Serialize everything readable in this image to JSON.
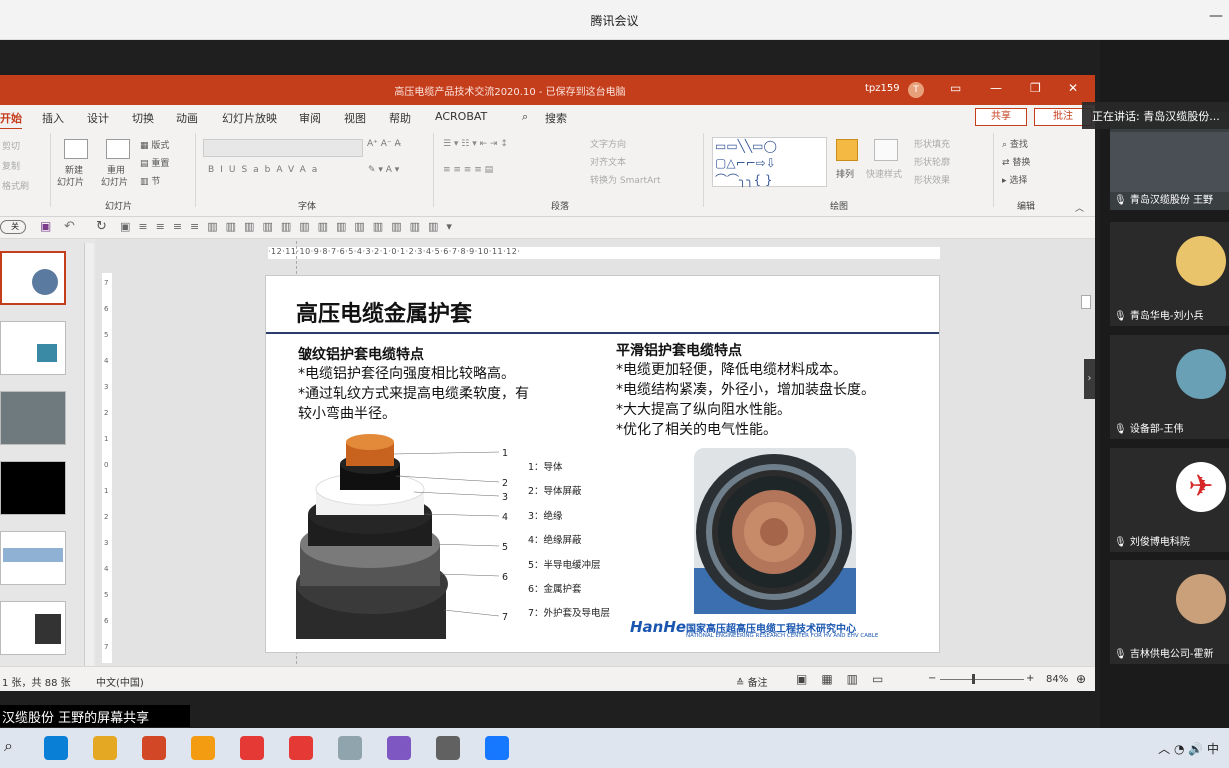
{
  "window": {
    "title": "腾讯会议",
    "min": "—"
  },
  "ppt": {
    "doc_title": "高压电缆产品技术交流2020.10 - 已保存到这台电脑",
    "user": "tpz159",
    "avatar": "T",
    "tabs": [
      "开始",
      "插入",
      "设计",
      "切换",
      "动画",
      "幻灯片放映",
      "审阅",
      "视图",
      "帮助",
      "ACROBAT"
    ],
    "search": "搜索",
    "share": "共享",
    "comment": "批注",
    "ribbon": {
      "clipboard": [
        "剪切",
        "复制",
        "格式刷"
      ],
      "slides": {
        "new": "新建",
        "new2": "幻灯片",
        "reuse": "重用",
        "reuse2": "幻灯片",
        "layout": "版式",
        "reset": "重置",
        "section": "节",
        "group": "幻灯片"
      },
      "font": {
        "group": "字体",
        "letters": [
          "B",
          "I",
          "U",
          "S",
          "ab",
          "AV",
          "Aa"
        ]
      },
      "paragraph": {
        "group": "段落",
        "text_dir": "文字方向",
        "align_text": "对齐文本",
        "smartart": "转换为 SmartArt"
      },
      "drawing": {
        "group": "绘图",
        "arrange": "排列",
        "quick_styles": "快速样式",
        "fill": "形状填充",
        "outline": "形状轮廓",
        "effects": "形状效果"
      },
      "editing": {
        "group": "编辑",
        "find": "查找",
        "replace": "替换",
        "select": "选择"
      }
    },
    "ruler": "·12·11·10·9·8·7·6·5·4·3·2·1·0·1·2·3·4·5·6·7·8·9·10·11·12·",
    "toggle_label": "关",
    "slide": {
      "title": "高压电缆金属护套",
      "left_heading": "皱纹铝护套电缆特点",
      "left_bullets": [
        "*电缆铝护套径向强度相比较略高。",
        "*通过轧纹方式来提高电缆柔软度，有",
        "较小弯曲半径。"
      ],
      "right_heading": "平滑铝护套电缆特点",
      "right_bullets": [
        "*电缆更加轻便，降低电缆材料成本。",
        "*电缆结构紧凑，外径小，增加装盘长度。",
        "*大大提高了纵向阻水性能。",
        "*优化了相关的电气性能。"
      ],
      "legend": [
        "1：导体",
        "2：导体屏蔽",
        "3：绝缘",
        "4：绝缘屏蔽",
        "5：半导电缓冲层",
        "6：金属护套",
        "7：外护套及导电层"
      ],
      "callout_numbers": [
        "1",
        "2",
        "3",
        "4",
        "5",
        "6",
        "7"
      ],
      "logo_cn": "国家高压超高压电缆工程技术研究中心",
      "logo_en": "NATIONAL ENGINEERING RESEARCH CENTER FOR HV AND EHV CABLE",
      "logo_mark": "HanHe"
    },
    "status": {
      "slide_count": "1 张，共 88 张",
      "lang": "中文(中国)",
      "notes": "备注",
      "zoom": "84%"
    }
  },
  "meeting": {
    "caption": "汉缆股份  王野的屏幕共享",
    "speaking": "正在讲话: 青岛汉缆股份...",
    "participants": [
      {
        "name": "青岛汉缆股份 王野"
      },
      {
        "name": "青岛华电-刘小兵"
      },
      {
        "name": "设备部-王伟"
      },
      {
        "name": "刘俊博电科院"
      },
      {
        "name": "吉林供电公司-霍新"
      }
    ]
  },
  "taskbar": {
    "ime": "中",
    "colors": [
      "#0a7fd6",
      "#e5a823",
      "#d24726",
      "#f39c12",
      "#e53935",
      "#e53935",
      "#90a4ae",
      "#7e57c2",
      "#616161",
      "#1677ff"
    ]
  }
}
